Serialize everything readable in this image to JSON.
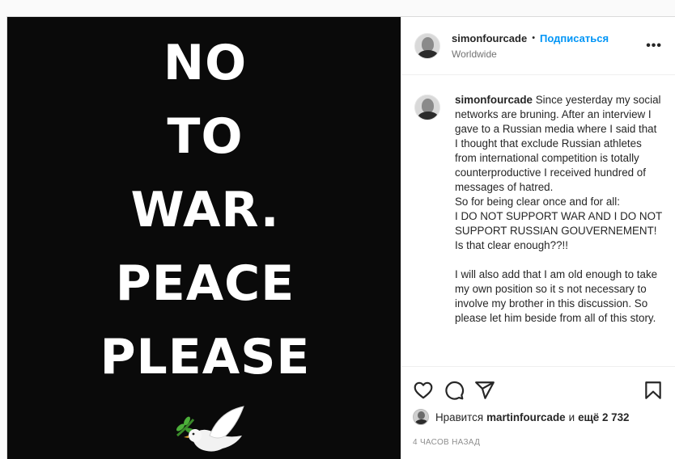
{
  "media": {
    "lines": [
      "NO",
      "TO",
      "WAR.",
      "PEACE",
      "PLEASE"
    ],
    "emoji": "dove-with-olive-branch"
  },
  "header": {
    "username": "simonfourcade",
    "separator": "•",
    "follow_label": "Подписаться",
    "location": "Worldwide",
    "more_label": "•••"
  },
  "caption": {
    "username": "simonfourcade",
    "text": "Since yesterday my social networks are bruning. After an interview I gave to a Russian media where I said that I thought that exclude Russian athletes from international competition is totally counterproductive I received hundred of messages of hatred.\nSo for being clear once and for all:\nI DO NOT SUPPORT WAR AND I DO NOT SUPPORT RUSSIAN GOUVERNEMENT!\nIs that clear enough??!!\n\nI will also add that I am old enough to take my own position so it s not necessary to involve my brother in this discussion. So please let him beside from all of this story."
  },
  "actions": {
    "icons": [
      "heart-icon",
      "comment-icon",
      "share-icon",
      "bookmark-icon"
    ]
  },
  "likes": {
    "prefix": "Нравится",
    "user": "martinfourcade",
    "middle": "и",
    "others": "ещё 2 732"
  },
  "timestamp": "4 часов назад",
  "colors": {
    "accent": "#0095f6",
    "media_bg": "#0a0a0a",
    "muted": "#8e8e8e"
  }
}
